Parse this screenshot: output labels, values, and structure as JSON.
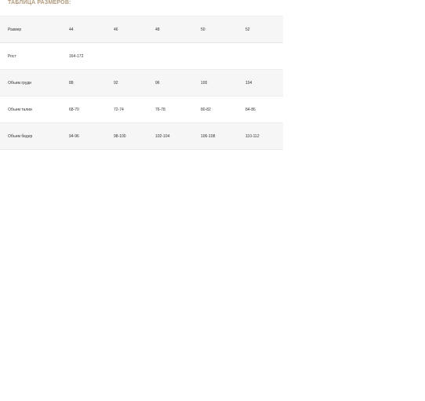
{
  "title": "ТАБЛИЦА РАЗМЕРОВ:",
  "table": {
    "rows": [
      {
        "label": "Размер",
        "cells": [
          "44",
          "46",
          "48",
          "50",
          "52"
        ]
      },
      {
        "label": "Рост",
        "cells": [
          "164-172",
          "",
          "",
          "",
          ""
        ]
      },
      {
        "label": "Объем груди",
        "cells": [
          "88",
          "92",
          "96",
          "100",
          "104"
        ]
      },
      {
        "label": "Объем талии",
        "cells": [
          "68-70",
          "72-74",
          "76-78",
          "80-82",
          "84-86"
        ]
      },
      {
        "label": "Объем бедер",
        "cells": [
          "94-96",
          "98-100",
          "102-104",
          "106-108",
          "110-112"
        ]
      }
    ]
  }
}
